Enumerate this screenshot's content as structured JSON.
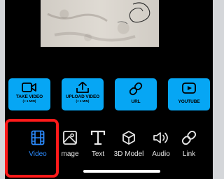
{
  "tiles": [
    {
      "id": "take-video",
      "line1": "TAKE VIDEO",
      "line2": "(< 1 MIN)",
      "icon": "video-camera-icon"
    },
    {
      "id": "upload-video",
      "line1": "UPLOAD VIDEO",
      "line2": "(< 1 MIN)",
      "icon": "upload-icon"
    },
    {
      "id": "url",
      "line1": "URL",
      "line2": "",
      "icon": "link-icon"
    },
    {
      "id": "youtube",
      "line1": "YOUTUBE",
      "line2": "",
      "icon": "youtube-play-icon"
    }
  ],
  "toolbar": [
    {
      "id": "video",
      "label": "Video",
      "icon": "film-icon",
      "active": true
    },
    {
      "id": "image",
      "label": "mage",
      "icon": "image-icon",
      "active": false
    },
    {
      "id": "text",
      "label": "Text",
      "icon": "text-t-icon",
      "active": false
    },
    {
      "id": "model3d",
      "label": "3D Model",
      "icon": "cube-icon",
      "active": false
    },
    {
      "id": "audio",
      "label": "Audio",
      "icon": "speaker-icon",
      "active": false
    },
    {
      "id": "link",
      "label": "Link",
      "icon": "link-icon",
      "active": false
    }
  ],
  "colors": {
    "tile": "#06a6f4",
    "accent": "#2c8cff",
    "highlight": "#ff1a1a",
    "background": "#000000"
  }
}
